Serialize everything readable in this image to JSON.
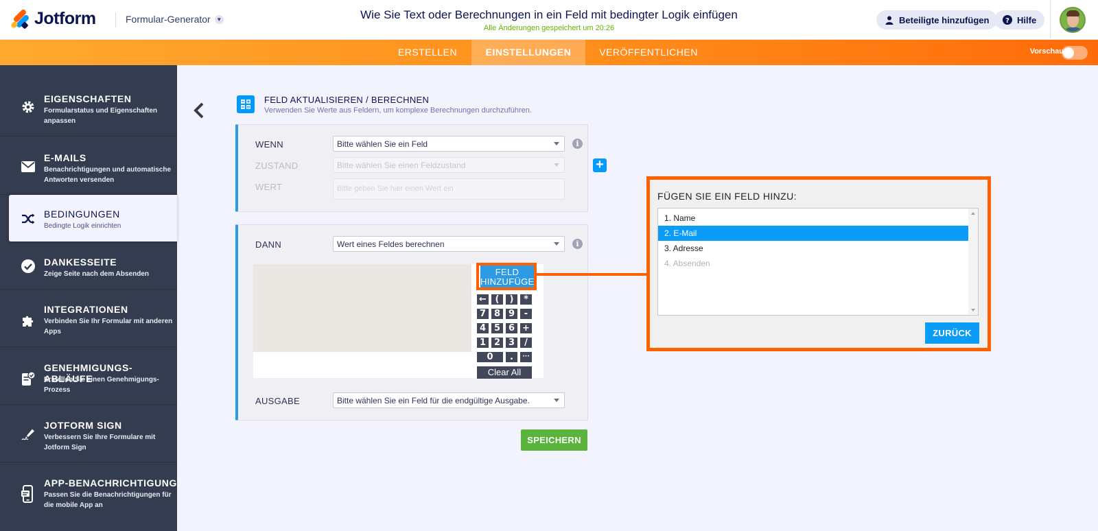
{
  "header": {
    "logo_text": "Jotform",
    "builder_label": "Formular-Generator",
    "page_title": "Wie Sie Text oder Berechnungen in ein Feld mit bedingter Logik einfügen",
    "saved_status": "Alle Änderungen gespeichert um 20:26",
    "add_participants": "Beteiligte hinzufügen",
    "help": "Hilfe"
  },
  "nav": {
    "tabs": [
      "ERSTELLEN",
      "EINSTELLUNGEN",
      "VERÖFFENTLICHEN"
    ],
    "active_tab": "EINSTELLUNGEN",
    "preview_label": "Vorschau",
    "preview_on": false
  },
  "sidebar": {
    "items": [
      {
        "title": "EIGENSCHAFTEN",
        "desc": "Formularstatus und Eigenschaften anpassen",
        "icon": "gear-icon"
      },
      {
        "title": "E-MAILS",
        "desc": "Benachrichtigungen und automatische Antworten versenden",
        "icon": "envelope-icon"
      },
      {
        "title": "BEDINGUNGEN",
        "desc": "Bedingte Logik einrichten",
        "icon": "shuffle-icon",
        "active": true
      },
      {
        "title": "DANKESSEITE",
        "desc": "Zeige Seite nach dem Absenden",
        "icon": "check-circle-icon"
      },
      {
        "title": "INTEGRATIONEN",
        "desc": "Verbinden Sie Ihr Formular mit anderen Apps",
        "icon": "puzzle-icon"
      },
      {
        "title": "GENEHMIGUNGS-ABLÄUFE",
        "desc": "Erstellen Sie einen Genehmigungs-Prozess",
        "icon": "approval-icon"
      },
      {
        "title": "JOTFORM SIGN",
        "desc": "Verbessern Sie Ihre Formulare mit Jotform Sign",
        "icon": "pen-icon"
      },
      {
        "title": "APP-BENACHRICHTIGUNG",
        "desc": "Passen Sie die Benachrichtigungen für die mobile App an",
        "icon": "mobile-icon"
      }
    ]
  },
  "section": {
    "title": "FELD AKTUALISIEREN / BERECHNEN",
    "subtitle": "Verwenden Sie Werte aus Feldern, um komplexe Berechnungen durchzuführen."
  },
  "condition": {
    "if_label": "WENN",
    "if_value": "Bitte wählen Sie ein Feld",
    "state_label": "ZUSTAND",
    "state_value": "Bitte wählen Sie einen Feldzustand",
    "value_label": "WERT",
    "value_placeholder": "Bitte geben Sie hier einen Wert ein"
  },
  "action": {
    "then_label": "DANN",
    "then_value": "Wert eines Feldes berechnen",
    "add_field_button": "FELD HINZUFÜGEN",
    "keys": [
      "←",
      "(",
      ")",
      "*",
      "7",
      "8",
      "9",
      "-",
      "4",
      "5",
      "6",
      "+",
      "1",
      "2",
      "3",
      "/",
      "0",
      ".",
      "···"
    ],
    "clear_all": "Clear All",
    "output_label": "AUSGABE",
    "output_value": "Bitte wählen Sie ein Feld für die endgültige Ausgabe."
  },
  "save_button": "SPEICHERN",
  "popup": {
    "title": "FÜGEN SIE EIN FELD HINZU:",
    "items": [
      {
        "label": "1. Name",
        "state": "normal"
      },
      {
        "label": "2. E-Mail",
        "state": "selected"
      },
      {
        "label": "3. Adresse",
        "state": "normal"
      },
      {
        "label": "4. Absenden",
        "state": "disabled"
      }
    ],
    "back_button": "ZURÜCK"
  },
  "colors": {
    "brand_orange": "#ff6100",
    "accent_blue": "#0099ff",
    "save_green": "#5ab33a",
    "sidebar_bg": "#343c4f"
  }
}
